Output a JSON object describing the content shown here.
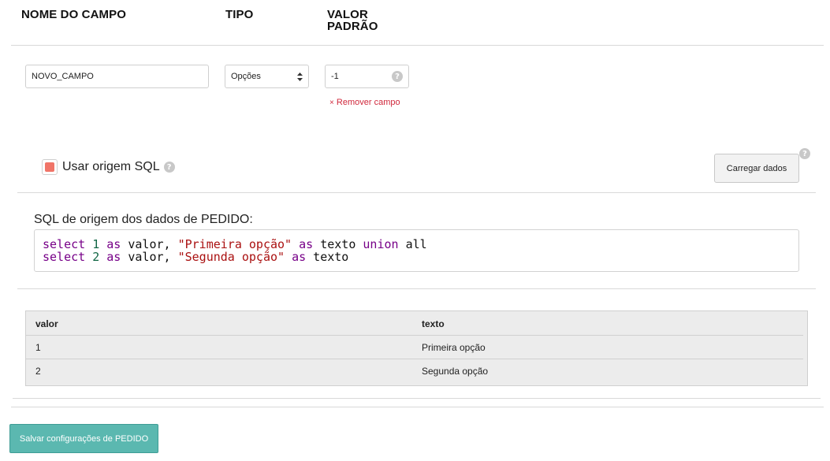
{
  "columns_header": {
    "field_name": "NOME DO CAMPO",
    "type": "TIPO",
    "default_line1": "VALOR",
    "default_line2": "PADRÃO"
  },
  "field": {
    "name_value": "NOVO_CAMPO",
    "type_value": "Opções",
    "default_value": "-1",
    "remove_icon": "×",
    "remove_label": "Remover campo",
    "help_icon": "question-icon"
  },
  "sql_origin": {
    "checkbox_label": "Usar origem SQL",
    "checked": true,
    "checkbox_color": "#f07468",
    "load_button": "Carregar dados",
    "editor_label": "SQL de origem dos dados de PEDIDO:",
    "code_lines": [
      "select 1 as valor, \"Primeira opção\" as texto union all",
      "select 2 as valor, \"Segunda opção\" as texto"
    ]
  },
  "results": {
    "headers": [
      "valor",
      "texto"
    ],
    "rows": [
      [
        "1",
        "Primeira opção"
      ],
      [
        "2",
        "Segunda opção"
      ]
    ]
  },
  "footer": {
    "save_button": "Salvar configurações de PEDIDO",
    "save_color": "#5bb8b0"
  },
  "colors": {
    "remove_link": "#d0283c",
    "keyword": "#770088",
    "number": "#116644",
    "string": "#aa1111"
  }
}
